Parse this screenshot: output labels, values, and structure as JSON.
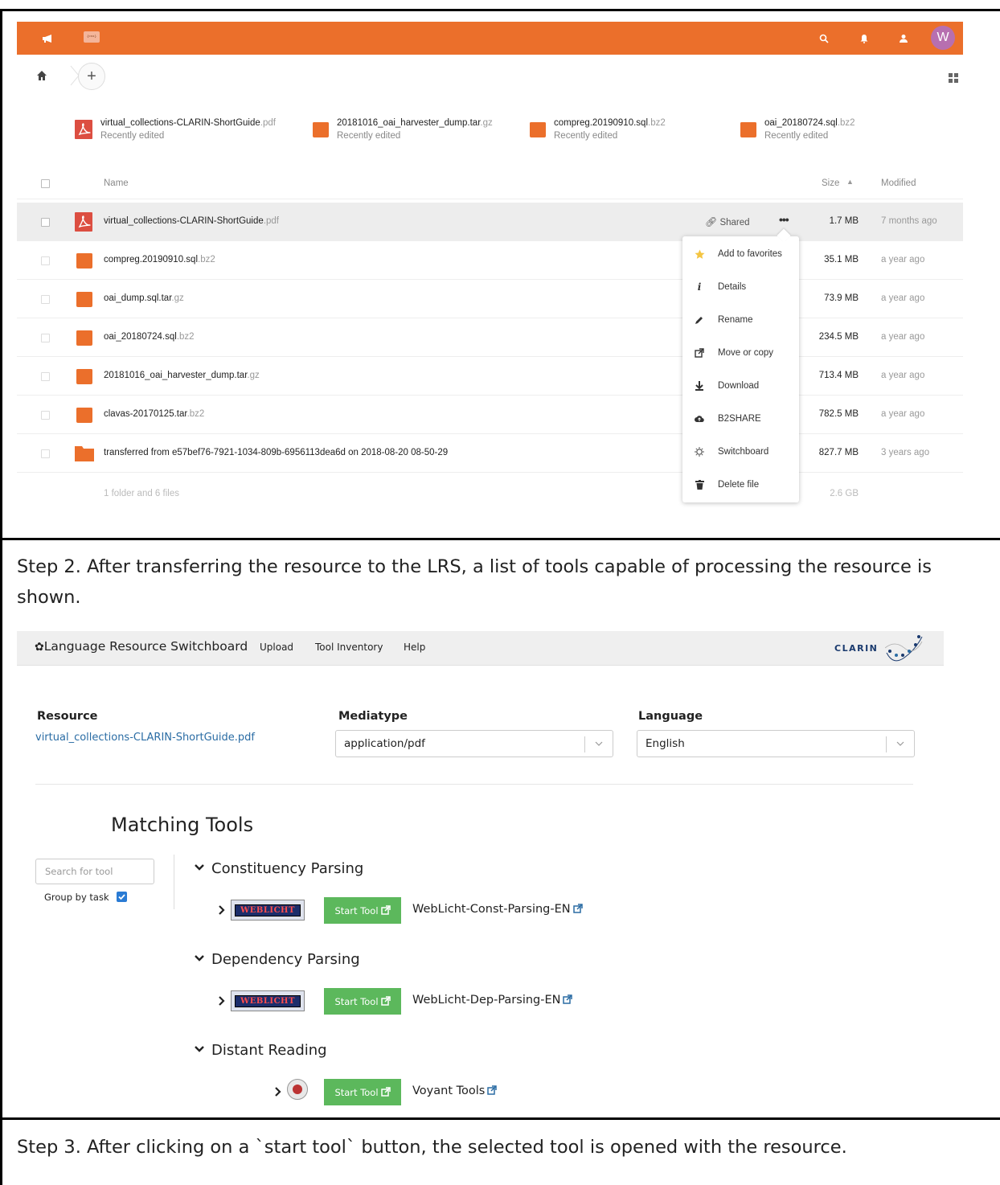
{
  "nextcloud": {
    "header": {
      "avatar_letter": "W",
      "accent_color": "#eb6f2b"
    },
    "recent_files": [
      {
        "name": "virtual_collections-CLARIN-ShortGuide",
        "ext": ".pdf",
        "status": "Recently edited",
        "icon": "pdf-icon"
      },
      {
        "name": "20181016_oai_harvester_dump.tar",
        "ext": ".gz",
        "status": "Recently edited",
        "icon": "archive-icon"
      },
      {
        "name": "compreg.20190910.sql",
        "ext": ".bz2",
        "status": "Recently edited",
        "icon": "archive-icon"
      },
      {
        "name": "oai_20180724.sql",
        "ext": ".bz2",
        "status": "Recently edited",
        "icon": "archive-icon"
      }
    ],
    "columns": {
      "name": "Name",
      "size": "Size",
      "modified": "Modified"
    },
    "files": [
      {
        "name": "virtual_collections-CLARIN-ShortGuide",
        "ext": ".pdf",
        "size": "1.7 MB",
        "modified": "7 months ago",
        "icon": "pdf-icon",
        "shared": "Shared"
      },
      {
        "name": "compreg.20190910.sql",
        "ext": ".bz2",
        "size": "35.1 MB",
        "modified": "a year ago",
        "icon": "archive-icon"
      },
      {
        "name": "oai_dump.sql.tar",
        "ext": ".gz",
        "size": "73.9 MB",
        "modified": "a year ago",
        "icon": "archive-icon"
      },
      {
        "name": "oai_20180724.sql",
        "ext": ".bz2",
        "size": "234.5 MB",
        "modified": "a year ago",
        "icon": "archive-icon"
      },
      {
        "name": "20181016_oai_harvester_dump.tar",
        "ext": ".gz",
        "size": "713.4 MB",
        "modified": "a year ago",
        "icon": "archive-icon"
      },
      {
        "name": "clavas-20170125.tar",
        "ext": ".bz2",
        "size": "782.5 MB",
        "modified": "a year ago",
        "icon": "archive-icon"
      },
      {
        "name": "transferred from e57bef76-7921-1034-809b-6956113dea6d on 2018-08-20 08-50-29",
        "ext": "",
        "size": "827.7 MB",
        "modified": "3 years ago",
        "icon": "folder-icon"
      }
    ],
    "footer": {
      "summary": "1 folder and 6 files",
      "total": "2.6 GB"
    },
    "context_menu": [
      {
        "label": "Add to favorites",
        "icon": "star-icon"
      },
      {
        "label": "Details",
        "icon": "info-icon"
      },
      {
        "label": "Rename",
        "icon": "pencil-icon"
      },
      {
        "label": "Move or copy",
        "icon": "external-icon"
      },
      {
        "label": "Download",
        "icon": "download-icon"
      },
      {
        "label": "B2SHARE",
        "icon": "cloud-upload-icon"
      },
      {
        "label": "Switchboard",
        "icon": "cog-icon"
      },
      {
        "label": "Delete file",
        "icon": "trash-icon"
      }
    ]
  },
  "captions": {
    "step2": "Step 2. After transferring the resource to the LRS, a list of tools capable of processing the resource is shown.",
    "step3": "Step 3. After clicking on a `start tool` button, the selected tool is opened with the resource."
  },
  "switchboard": {
    "brand": "Language Resource Switchboard",
    "nav": [
      "Upload",
      "Tool Inventory",
      "Help"
    ],
    "clarin_word": "CLARIN",
    "resource_label": "Resource",
    "resource_value": "virtual_collections-CLARIN-ShortGuide.pdf",
    "mediatype_label": "Mediatype",
    "mediatype_value": "application/pdf",
    "language_label": "Language",
    "language_value": "English",
    "matching_title": "Matching Tools",
    "search_placeholder": "Search for tool",
    "group_by_label": "Group by task",
    "group_by_checked": true,
    "start_label": "Start Tool",
    "groups": [
      {
        "title": "Constituency Parsing",
        "tool": "WebLicht-Const-Parsing-EN",
        "logo": "WEBLICHT"
      },
      {
        "title": "Dependency Parsing",
        "tool": "WebLicht-Dep-Parsing-EN",
        "logo": "WEBLICHT"
      },
      {
        "title": "Distant Reading",
        "tool": "Voyant Tools",
        "logo": ""
      }
    ]
  }
}
